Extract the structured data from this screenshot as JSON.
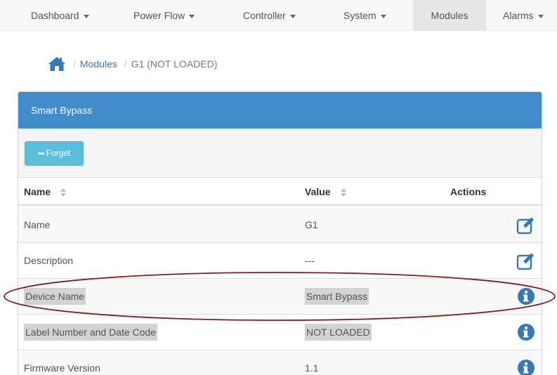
{
  "nav": {
    "items": [
      {
        "label": "Dashboard",
        "dropdown": true,
        "active": false
      },
      {
        "label": "Power Flow",
        "dropdown": true,
        "active": false
      },
      {
        "label": "Controller",
        "dropdown": true,
        "active": false
      },
      {
        "label": "System",
        "dropdown": true,
        "active": false
      },
      {
        "label": "Modules",
        "dropdown": false,
        "active": true
      },
      {
        "label": "Alarms",
        "dropdown": true,
        "active": false
      }
    ]
  },
  "breadcrumb": {
    "home_icon": "home-icon",
    "separator": "/",
    "link": "Modules",
    "current": "G1 (NOT LOADED)"
  },
  "panel": {
    "title": "Smart Bypass",
    "forget_label": "Forget",
    "columns": {
      "name": "Name",
      "value": "Value",
      "actions": "Actions"
    },
    "rows": [
      {
        "name": "Name",
        "value": "G1",
        "action_icon": "edit-icon",
        "highlighted": false
      },
      {
        "name": "Description",
        "value": "---",
        "action_icon": "edit-icon",
        "highlighted": false
      },
      {
        "name": "Device Name",
        "value": "Smart Bypass",
        "action_icon": "info-icon",
        "highlighted": true
      },
      {
        "name": "Label Number and Date Code",
        "value": "NOT LOADED",
        "action_icon": "info-icon",
        "highlighted": true
      },
      {
        "name": "Firmware Version",
        "value": "1.1",
        "action_icon": "info-icon",
        "highlighted": false
      }
    ]
  },
  "colors": {
    "panel_header": "#428bca",
    "forget_button": "#5bc0de",
    "action_icon": "#337ab7",
    "annotation_ellipse": "#8b1a1a"
  }
}
